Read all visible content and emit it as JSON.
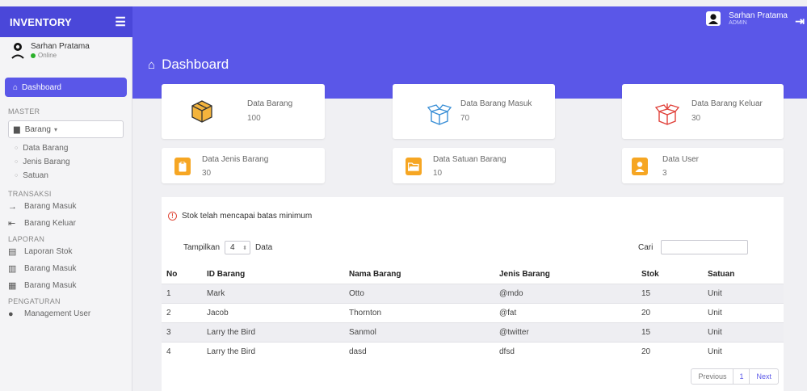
{
  "app": {
    "brand": "INVENTORY"
  },
  "topbar": {
    "user_name": "Sarhan Pratama",
    "user_role": "ADMIN"
  },
  "sidebar": {
    "user_name": "Sarhan Pratama",
    "user_status": "Online",
    "dashboard": "Dashboard",
    "section_master": "MASTER",
    "barang_dropdown": "Barang",
    "barang_items": [
      "Data Barang",
      "Jenis Barang",
      "Satuan"
    ],
    "section_transaksi": "TRANSAKSI",
    "transaksi_items": [
      "Barang Masuk",
      "Barang Keluar"
    ],
    "section_laporan": "LAPORAN",
    "laporan_items": [
      "Laporan Stok",
      "Barang Masuk",
      "Barang Masuk"
    ],
    "section_pengaturan": "PENGATURAN",
    "pengaturan_items": [
      "Management User"
    ]
  },
  "page": {
    "title": "Dashboard"
  },
  "cards": [
    {
      "label": "Data Barang",
      "value": "100",
      "icon": "box-icon"
    },
    {
      "label": "Data Barang Masuk",
      "value": "70",
      "icon": "open-box-icon"
    },
    {
      "label": "Data Barang Keluar",
      "value": "30",
      "icon": "open-box-red-icon"
    },
    {
      "label": "Data Jenis Barang",
      "value": "30",
      "icon": "clipboard-icon"
    },
    {
      "label": "Data Satuan Barang",
      "value": "10",
      "icon": "folder-icon"
    },
    {
      "label": "Data User",
      "value": "3",
      "icon": "user-icon"
    }
  ],
  "table_panel": {
    "alert": "Stok telah mencapai batas minimum",
    "show_label": "Tampilkan",
    "show_value": "4",
    "show_suffix": "Data",
    "search_label": "Cari",
    "search_value": "",
    "columns": [
      "No",
      "ID Barang",
      "Nama Barang",
      "Jenis Barang",
      "Stok",
      "Satuan"
    ],
    "rows": [
      [
        "1",
        "Mark",
        "Otto",
        "@mdo",
        "15",
        "Unit"
      ],
      [
        "2",
        "Jacob",
        "Thornton",
        "@fat",
        "20",
        "Unit"
      ],
      [
        "3",
        "Larry the Bird",
        "Sanmol",
        "@twitter",
        "15",
        "Unit"
      ],
      [
        "4",
        "Larry the Bird",
        "dasd",
        "dfsd",
        "20",
        "Unit"
      ]
    ],
    "pager": {
      "prev": "Previous",
      "page": "1",
      "next": "Next"
    }
  },
  "colors": {
    "primary": "#5a57e8",
    "accent_orange": "#f6a623",
    "alert_red": "#e04a3a"
  }
}
